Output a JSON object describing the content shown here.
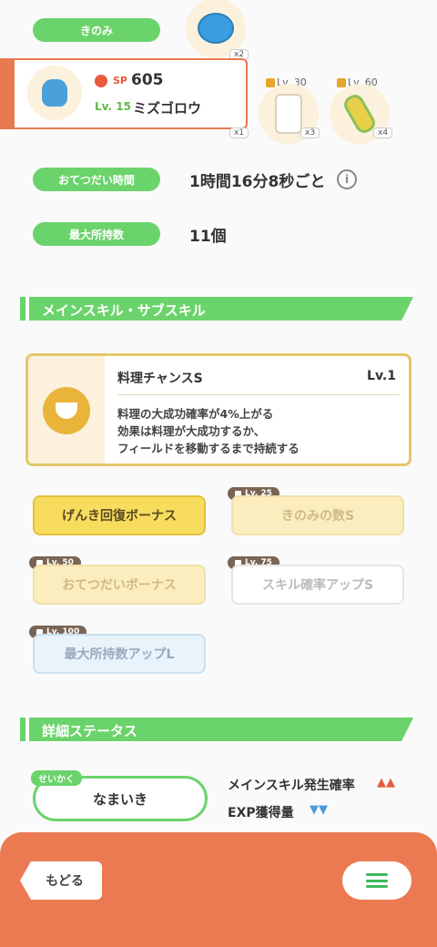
{
  "berry": {
    "label": "きのみ",
    "count": "x2"
  },
  "pokemon": {
    "sp_label": "SP",
    "sp": "605",
    "level": "Lv. 15",
    "name": "ミズゴロウ"
  },
  "ingredients": [
    {
      "lv": "",
      "count": "x1"
    },
    {
      "lv": "Lv. 30",
      "count": "x3"
    },
    {
      "lv": "Lv. 60",
      "count": "x4"
    }
  ],
  "help": {
    "label": "おてつだい時間",
    "value": "1時間16分8秒ごと"
  },
  "capacity": {
    "label": "最大所持数",
    "value": "11個"
  },
  "skills_section": "メインスキル・サブスキル",
  "main_skill": {
    "name": "料理チャンスS",
    "level": "Lv.1",
    "desc1": "料理の大成功確率が4%上がる",
    "desc2": "効果は料理が大成功するか、",
    "desc3": "フィールドを移動するまで持続する"
  },
  "subskills": [
    {
      "name": "げんき回復ボーナス",
      "lv": ""
    },
    {
      "name": "きのみの数S",
      "lv": "Lv. 25"
    },
    {
      "name": "おてつだいボーナス",
      "lv": "Lv. 50"
    },
    {
      "name": "スキル確率アップS",
      "lv": "Lv. 75"
    },
    {
      "name": "最大所持数アップL",
      "lv": "Lv. 100"
    }
  ],
  "detail_section": "詳細ステータス",
  "nature": {
    "tag": "せいかく",
    "name": "なまいき",
    "up": "メインスキル発生確率",
    "up_arrows": "▲▲",
    "down": "EXP獲得量",
    "down_arrows": "▼▼"
  },
  "footer": {
    "back": "もどる"
  }
}
